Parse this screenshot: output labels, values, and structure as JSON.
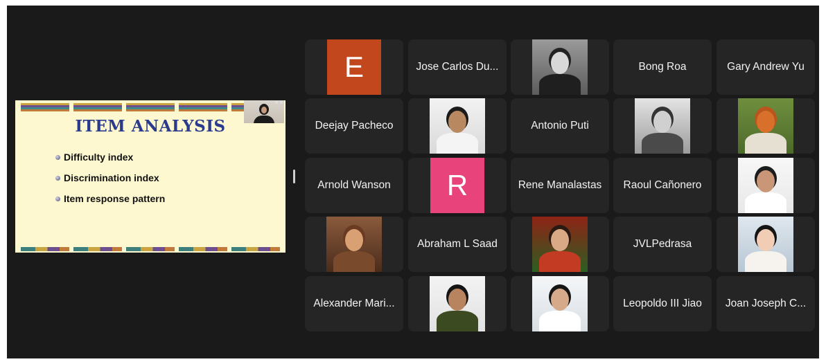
{
  "shared_screen": {
    "title": "ITEM ANALYSIS",
    "bullets": [
      "Difficulty index",
      "Discrimination index",
      "Item response pattern"
    ]
  },
  "participants": [
    {
      "type": "letter",
      "letter": "E",
      "color": "#c2471d"
    },
    {
      "type": "name",
      "name": "Jose Carlos Du..."
    },
    {
      "type": "photo",
      "photo": "man-glasses-bw"
    },
    {
      "type": "name",
      "name": "Bong Roa"
    },
    {
      "type": "name",
      "name": "Gary Andrew Yu"
    },
    {
      "type": "name",
      "name": "Deejay Pacheco"
    },
    {
      "type": "photo",
      "photo": "man-white-collar"
    },
    {
      "type": "name",
      "name": "Antonio Puti"
    },
    {
      "type": "photo",
      "photo": "pilot-helmet-bw"
    },
    {
      "type": "photo",
      "photo": "red-fox"
    },
    {
      "type": "name",
      "name": "Arnold Wanson"
    },
    {
      "type": "letter",
      "letter": "R",
      "color": "#e8437a"
    },
    {
      "type": "name",
      "name": "Rene Manalastas"
    },
    {
      "type": "name",
      "name": "Raoul Cañonero"
    },
    {
      "type": "photo",
      "photo": "doctor-white-coat"
    },
    {
      "type": "photo",
      "photo": "toddler"
    },
    {
      "type": "name",
      "name": "Abraham L Saad"
    },
    {
      "type": "photo",
      "photo": "woman-logo-badge"
    },
    {
      "type": "name",
      "name": "JVLPedrasa"
    },
    {
      "type": "photo",
      "photo": "woman-portrait"
    },
    {
      "type": "name",
      "name": "Alexander Mari..."
    },
    {
      "type": "photo",
      "photo": "man-green-shirt"
    },
    {
      "type": "photo",
      "photo": "doctor-glasses"
    },
    {
      "type": "name",
      "name": "Leopoldo III Jiao"
    },
    {
      "type": "name",
      "name": "Joan Joseph C..."
    }
  ]
}
